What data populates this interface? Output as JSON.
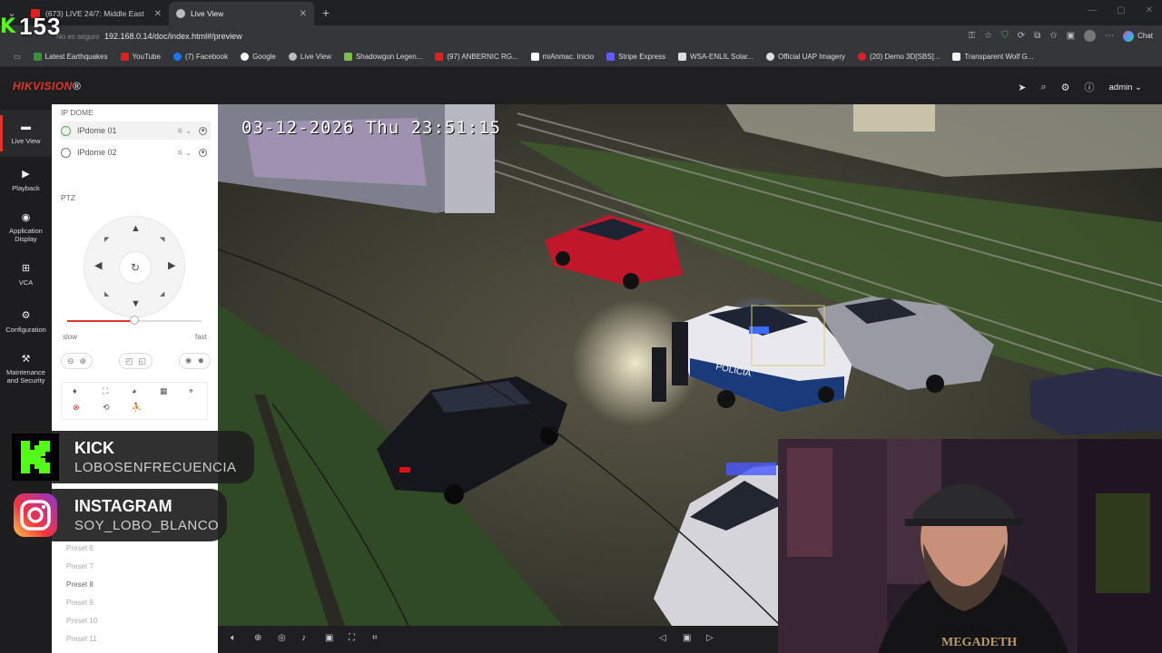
{
  "browser": {
    "tabs": [
      {
        "title": "(673) LIVE 24/7: Middle East",
        "favicon_color": "#e02020"
      },
      {
        "title": "Live View",
        "favicon_color": "#bbbbbb"
      }
    ],
    "url_prefix": "No es seguro",
    "url": "192.168.0.14/doc/index.html#/preview",
    "chat_label": "Chat",
    "bookmarks": [
      {
        "label": "Latest Earthquakes",
        "color": "#3a8f3a"
      },
      {
        "label": "YouTube",
        "color": "#e02020"
      },
      {
        "label": "(7) Facebook",
        "color": "#1877f2"
      },
      {
        "label": "Google",
        "color": "#ffffff"
      },
      {
        "label": "Live View",
        "color": "#bbbbbb"
      },
      {
        "label": "Shadowgun Legen...",
        "color": "#7bc043"
      },
      {
        "label": "(97) ANBERNIC RG...",
        "color": "#e02020"
      },
      {
        "label": "miAnmac. Inicio",
        "color": "#ffffff"
      },
      {
        "label": "Stripe Express",
        "color": "#635bff"
      },
      {
        "label": "WSA-ENLIL Solar...",
        "color": "#dddddd"
      },
      {
        "label": "Official UAP Imagery",
        "color": "#dddddd"
      },
      {
        "label": "(20) Demo 3D[SBS]...",
        "color": "#e02020"
      },
      {
        "label": "Transparent Wolf G...",
        "color": "#f0f0f0"
      }
    ]
  },
  "overlay": {
    "kick_counter": "153",
    "socials": [
      {
        "platform": "KICK",
        "handle": "LOBOSENFRECUENCIA"
      },
      {
        "platform": "INSTAGRAM",
        "handle": "SOY_LOBO_BLANCO"
      }
    ]
  },
  "app": {
    "brand": "HIKVISION",
    "brand_mark": "®",
    "user": "admin",
    "accent": "#e0342b"
  },
  "nav": [
    {
      "label": "Live View",
      "icon": "live-view-icon"
    },
    {
      "label": "Playback",
      "icon": "playback-icon"
    },
    {
      "label": "Application Display",
      "icon": "application-icon"
    },
    {
      "label": "VCA",
      "icon": "vca-icon"
    },
    {
      "label": "Configuration",
      "icon": "gear-icon"
    },
    {
      "label": "Maintenance and Security",
      "icon": "maintenance-icon"
    }
  ],
  "panel": {
    "group_title": "IP DOME",
    "cameras": [
      "IPdome 01",
      "IPdome 02"
    ],
    "ptz_title": "PTZ",
    "speed_slow": "slow",
    "speed_fast": "fast",
    "speed_value": 0.5,
    "presets": [
      "Preset 6",
      "Preset 7",
      "Preset 8",
      "Preset 9",
      "Preset 10",
      "Preset 11"
    ]
  },
  "video": {
    "osd": "03-12-2026 Thu 23:51:15"
  }
}
